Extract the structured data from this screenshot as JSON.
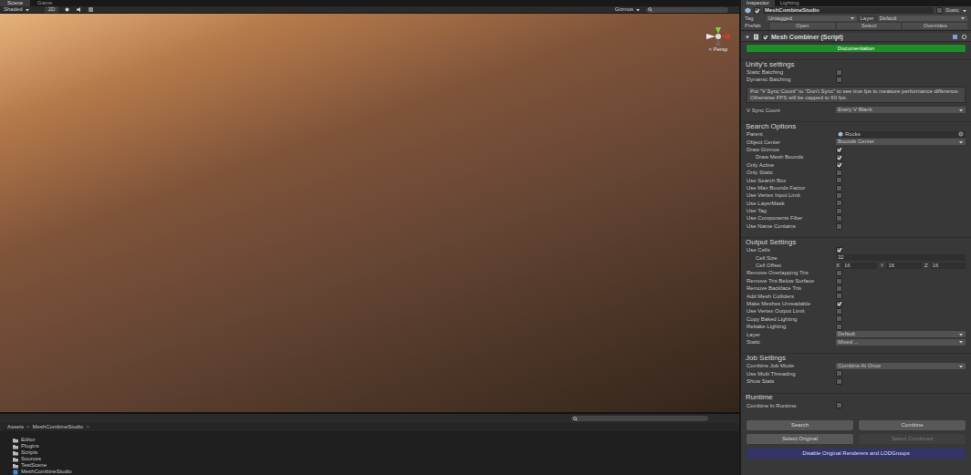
{
  "scene_tabs": [
    {
      "label": "Scene",
      "selected": true
    },
    {
      "label": "Game",
      "selected": false
    }
  ],
  "scene_toolbar": {
    "shading": "Shaded",
    "mode_2d": "2D",
    "gizmos": "Gizmos"
  },
  "viewport": {
    "projection": "< Persp"
  },
  "project": {
    "path": [
      "Assets",
      "MeshCombineStudio"
    ],
    "separator": ">",
    "items": [
      {
        "name": "Editor",
        "kind": "folder"
      },
      {
        "name": "Plugins",
        "kind": "folder"
      },
      {
        "name": "Scripts",
        "kind": "folder"
      },
      {
        "name": "Sources",
        "kind": "folder"
      },
      {
        "name": "TestScene",
        "kind": "folder"
      },
      {
        "name": "MeshCombineStudio",
        "kind": "prefab"
      }
    ]
  },
  "inspector_tabs": [
    {
      "label": "Inspector",
      "selected": true
    },
    {
      "label": "Lighting",
      "selected": false
    }
  ],
  "object": {
    "active": true,
    "name": "MeshCombineStudio",
    "static_label": "Static",
    "static": false,
    "tag_label": "Tag",
    "tag": "Untagged",
    "layer_label": "Layer",
    "layer": "Default",
    "prefab_label": "Prefab",
    "prefab_buttons": [
      "Open",
      "Select",
      "Overrides"
    ]
  },
  "component": {
    "enabled": true,
    "title": "Mesh Combiner (Script)",
    "doc_button": "Documentation"
  },
  "sections": [
    {
      "title": "Unity's settings",
      "rows": [
        {
          "kind": "toggle",
          "label": "Static Batching",
          "checked": false,
          "indented": false
        },
        {
          "kind": "toggle",
          "label": "Dynamic Batching",
          "checked": false,
          "indented": false
        },
        {
          "kind": "info",
          "text": "Put \"V Sync Count\" to \"Don't Sync\" to see true fps to measure performance difference. Otherwise FPS will be capped to 60 fps.",
          "indented": false
        },
        {
          "kind": "dropdown",
          "label": "V Sync Count",
          "value": "Every V Blank",
          "indented": false
        }
      ]
    },
    {
      "title": "Search Options",
      "rows": [
        {
          "kind": "object",
          "label": "Parent",
          "value": "Rocks",
          "indented": false
        },
        {
          "kind": "dropdown",
          "label": "Object Center",
          "value": "Bounds Center",
          "indented": false
        },
        {
          "kind": "toggle",
          "label": "Draw Gizmos",
          "checked": true,
          "indented": false
        },
        {
          "kind": "toggle",
          "label": "Draw Mesh Bounds",
          "checked": true,
          "indented": true
        },
        {
          "kind": "toggle",
          "label": "Only Active",
          "checked": true,
          "indented": false
        },
        {
          "kind": "toggle",
          "label": "Only Static",
          "checked": false,
          "indented": false
        },
        {
          "kind": "toggle",
          "label": "Use Search Box",
          "checked": false,
          "indented": false
        },
        {
          "kind": "toggle",
          "label": "Use Max Bounds Factor",
          "checked": false,
          "indented": false
        },
        {
          "kind": "toggle",
          "label": "Use Vertex Input Limit",
          "checked": false,
          "indented": false
        },
        {
          "kind": "toggle",
          "label": "Use LayerMask",
          "checked": false,
          "indented": false
        },
        {
          "kind": "toggle",
          "label": "Use Tag",
          "checked": false,
          "indented": false
        },
        {
          "kind": "toggle",
          "label": "Use Components Filter",
          "checked": false,
          "indented": false
        },
        {
          "kind": "toggle",
          "label": "Use Name Contains",
          "checked": false,
          "indented": false
        }
      ]
    },
    {
      "title": "Output Settings",
      "rows": [
        {
          "kind": "toggle",
          "label": "Use Cells",
          "checked": true,
          "indented": false
        },
        {
          "kind": "number",
          "label": "Cell Size",
          "value": "32",
          "indented": true
        },
        {
          "kind": "vector3",
          "label": "Cell Offset",
          "axes": [
            {
              "axis": "X",
              "value": "16"
            },
            {
              "axis": "Y",
              "value": "16"
            },
            {
              "axis": "Z",
              "value": "16"
            }
          ],
          "indented": true
        },
        {
          "kind": "toggle",
          "label": "Remove Overlapping Tris",
          "checked": false,
          "indented": false
        },
        {
          "kind": "toggle",
          "label": "Remove Tris Below Surface",
          "checked": false,
          "indented": false
        },
        {
          "kind": "toggle",
          "label": "Remove Backface Tris",
          "checked": false,
          "indented": false
        },
        {
          "kind": "toggle",
          "label": "Add Mesh Colliders",
          "checked": false,
          "indented": false
        },
        {
          "kind": "toggle",
          "label": "Make Meshes Unreadable",
          "checked": true,
          "indented": false
        },
        {
          "kind": "toggle",
          "label": "Use Vertex Output Limit",
          "checked": false,
          "indented": false
        },
        {
          "kind": "toggle",
          "label": "Copy Baked Lighting",
          "checked": false,
          "indented": false
        },
        {
          "kind": "toggle",
          "label": "Rebake Lighting",
          "checked": false,
          "indented": false
        },
        {
          "kind": "dropdown",
          "label": "Layer",
          "value": "Default",
          "indented": false
        },
        {
          "kind": "dropdown",
          "label": "Static",
          "value": "Mixed ...",
          "indented": false
        }
      ]
    },
    {
      "title": "Job Settings",
      "rows": [
        {
          "kind": "dropdown",
          "label": "Combine Job Mode",
          "value": "Combine At Once",
          "indented": false
        },
        {
          "kind": "toggle",
          "label": "Use Multi Threading",
          "checked": false,
          "indented": false
        },
        {
          "kind": "toggle",
          "label": "Show Stats",
          "checked": false,
          "indented": false
        }
      ]
    },
    {
      "title": "Runtime",
      "rows": [
        {
          "kind": "toggle",
          "label": "Combine In Runtime",
          "checked": false,
          "indented": false
        }
      ]
    }
  ],
  "actions": {
    "rows": [
      [
        {
          "label": "Search",
          "disabled": false
        },
        {
          "label": "Combine",
          "disabled": false
        }
      ],
      [
        {
          "label": "Select Original",
          "disabled": false
        },
        {
          "label": "Select Combined",
          "disabled": true
        }
      ]
    ],
    "wide": {
      "label": "Disable Original Renderers and LODGroups"
    }
  }
}
